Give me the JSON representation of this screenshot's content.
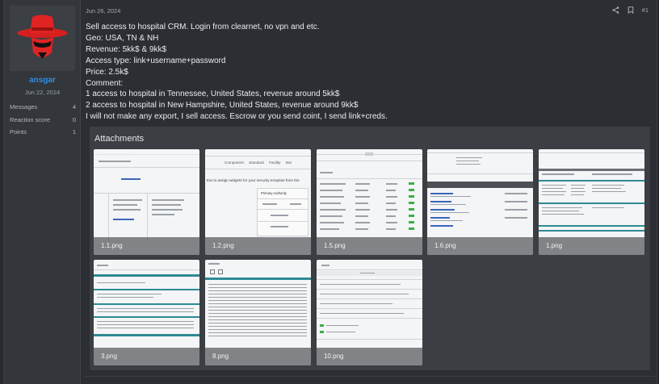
{
  "post": {
    "date": "Jun 26, 2024",
    "number": "#1",
    "body_lines": [
      "Sell access to hospital CRM. Login from clearnet, no vpn and etc.",
      "Geo: USA, TN & NH",
      "Revenue: 5kk$ & 9kk$",
      "Access type: link+username+password",
      "Price: 2.5k$",
      "Comment:",
      "1 access to hospital in Tennessee, United States, revenue around 5kk$",
      "2 access to hospital in New Hampshire, United States, revenue around 9kk$",
      "I will not make any export, I sell access. Escrow or you send coint, I send link+creds."
    ]
  },
  "user": {
    "name": "ansgar",
    "joined": "Jun 22, 2024",
    "stats": [
      {
        "label": "Messages",
        "value": "4"
      },
      {
        "label": "Reaction score",
        "value": "0"
      },
      {
        "label": "Points",
        "value": "1"
      }
    ]
  },
  "attachments": {
    "title": "Attachments",
    "files": [
      "1.1.png",
      "1.2.png",
      "1.5.png",
      "1.6.png",
      "1.png",
      "3.png",
      "8.png",
      "10.png"
    ],
    "thumb2_header": [
      "Component",
      "Standard",
      "Facility",
      "Bot"
    ],
    "thumb2_text": "Ear to assign widgets for your security template from the",
    "thumb2_panel": "Primary Authority"
  },
  "icons": {
    "share": "share-icon",
    "bookmark": "bookmark-icon"
  },
  "colors": {
    "username": "#2f8ee0",
    "accent_teal": "#2e8a94",
    "status_green": "#3cae4a"
  }
}
